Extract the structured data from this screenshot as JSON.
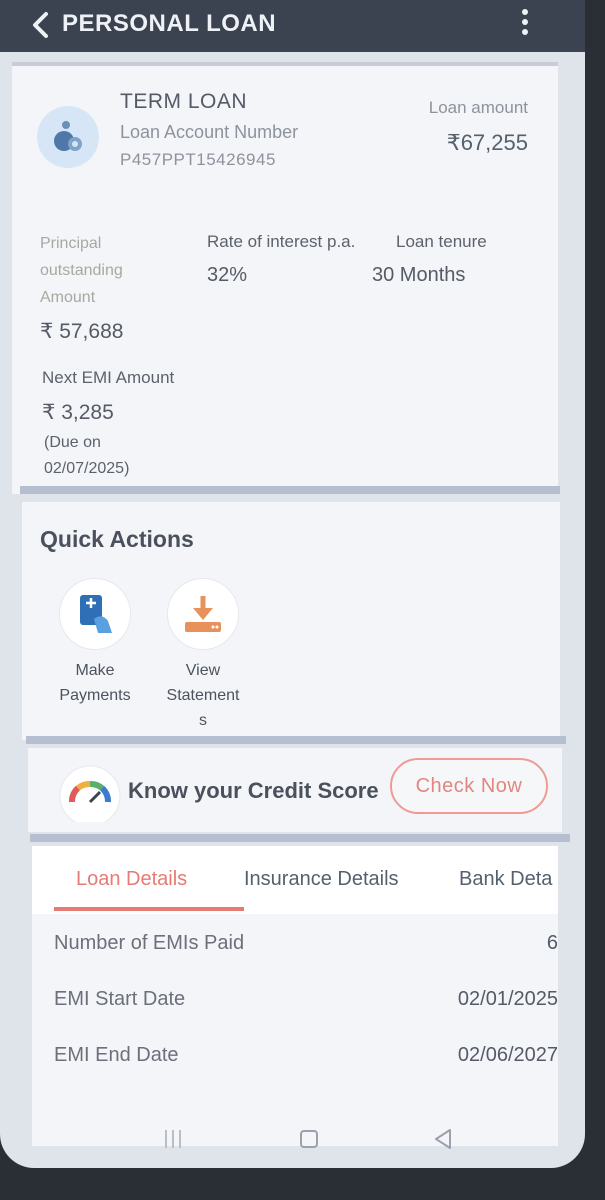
{
  "header": {
    "title": "PERSONAL LOAN"
  },
  "summary": {
    "loan_type": "TERM LOAN",
    "account_label": "Loan Account Number",
    "account_number": "P457PPT15426945",
    "amount_label": "Loan amount",
    "amount_value": "₹67,255",
    "principal_label": "Principal outstanding Amount",
    "principal_value": "₹ 57,688",
    "roi_label": "Rate of interest p.a.",
    "roi_value": "32%",
    "tenure_label": "Loan tenure",
    "tenure_value": "30 Months",
    "emi_label": "Next EMI Amount",
    "emi_value": "₹ 3,285",
    "due_line1": "(Due on",
    "due_line2": "02/07/2025)"
  },
  "quick_actions": {
    "title": "Quick Actions",
    "items": [
      {
        "label_line1": "Make",
        "label_line2": "Payments"
      },
      {
        "label_line1": "View",
        "label_line2": "Statement",
        "label_line3": "s"
      }
    ]
  },
  "credit": {
    "text": "Know your Credit Score",
    "button": "Check Now"
  },
  "details": {
    "tabs": [
      "Loan Details",
      "Insurance Details",
      "Bank Deta"
    ],
    "rows": [
      {
        "label": "Number of EMIs Paid",
        "value": "6"
      },
      {
        "label": "EMI Start Date",
        "value": "02/01/2025"
      },
      {
        "label": "EMI End Date",
        "value": "02/06/2027"
      }
    ]
  },
  "colors": {
    "accent": "#e67b73",
    "header": "#3b4250",
    "icon_blue": "#2f6fb6",
    "icon_orange": "#e8915a"
  },
  "icons": [
    "chevron-left-icon",
    "more-vertical-icon",
    "money-bag-icon",
    "payment-icon",
    "download-icon",
    "gauge-icon",
    "menu-icon",
    "home-icon",
    "back-icon"
  ]
}
